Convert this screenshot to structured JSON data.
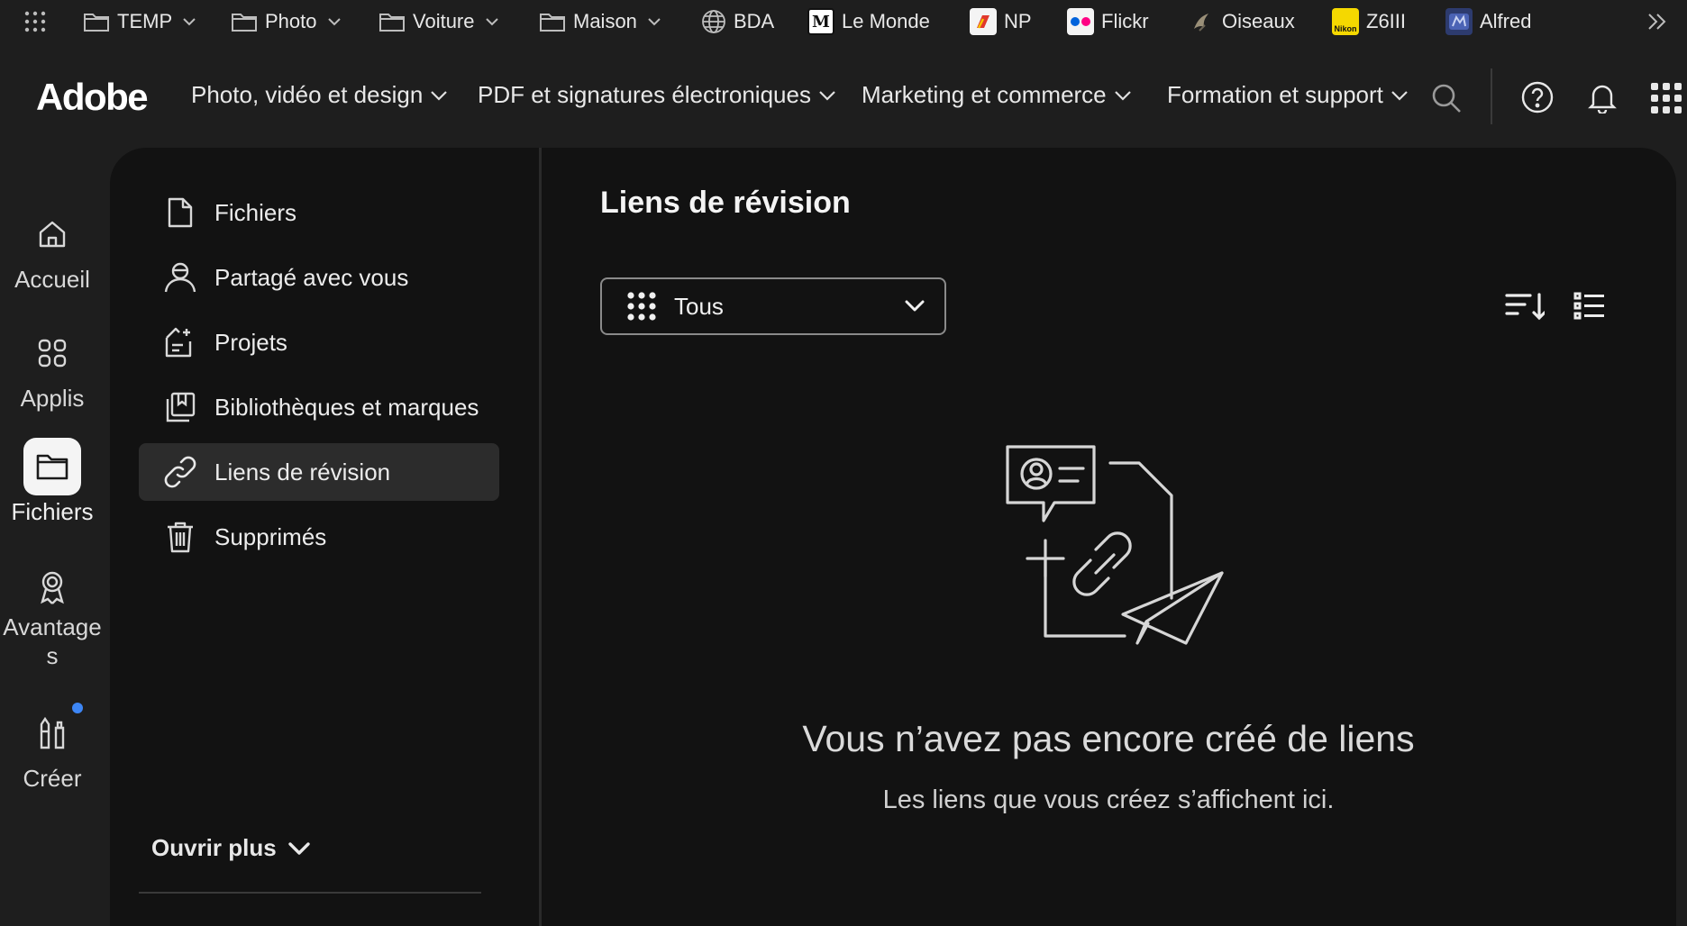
{
  "bookmarks": {
    "items": [
      {
        "label": "TEMP",
        "icon": "folder-icon",
        "dropdown": true
      },
      {
        "label": "Photo",
        "icon": "folder-icon",
        "dropdown": true
      },
      {
        "label": "Voiture",
        "icon": "folder-icon",
        "dropdown": true
      },
      {
        "label": "Maison",
        "icon": "folder-icon",
        "dropdown": true
      },
      {
        "label": "BDA",
        "icon": "globe-icon",
        "dropdown": false
      },
      {
        "label": "Le Monde",
        "icon": "le-monde-favicon",
        "dropdown": false
      },
      {
        "label": "NP",
        "icon": "np-favicon",
        "dropdown": false
      },
      {
        "label": "Flickr",
        "icon": "flickr-favicon",
        "dropdown": false
      },
      {
        "label": "Oiseaux",
        "icon": "bird-favicon",
        "dropdown": false
      },
      {
        "label": "Z6III",
        "icon": "nikon-favicon",
        "dropdown": false
      },
      {
        "label": "Alfred",
        "icon": "alfred-favicon",
        "dropdown": false
      }
    ],
    "favicon_text": {
      "le_monde": "M",
      "nikon": "Nikon"
    }
  },
  "nav": {
    "logo": "Adobe",
    "items": [
      {
        "label": "Photo, vidéo et design"
      },
      {
        "label": "PDF et signatures électroniques"
      },
      {
        "label": "Marketing et commerce"
      },
      {
        "label": "Formation et support"
      }
    ]
  },
  "rail": {
    "items": [
      {
        "label": "Accueil",
        "icon": "home-icon",
        "active": false
      },
      {
        "label": "Applis",
        "icon": "apps-icon",
        "active": false
      },
      {
        "label": "Fichiers",
        "icon": "folder-icon",
        "active": true
      },
      {
        "label": "Avantage\ns",
        "icon": "award-icon",
        "active": false
      },
      {
        "label": "Créer",
        "icon": "create-icon",
        "active": false,
        "notification": true
      }
    ]
  },
  "sidebar": {
    "items": [
      {
        "label": "Fichiers",
        "icon": "file-icon",
        "active": false
      },
      {
        "label": "Partagé avec vous",
        "icon": "shared-icon",
        "active": false
      },
      {
        "label": "Projets",
        "icon": "projects-icon",
        "active": false
      },
      {
        "label": "Bibliothèques et marques",
        "icon": "library-icon",
        "active": false
      },
      {
        "label": "Liens de révision",
        "icon": "link-icon",
        "active": true
      },
      {
        "label": "Supprimés",
        "icon": "trash-icon",
        "active": false
      }
    ],
    "open_more": "Ouvrir plus"
  },
  "main": {
    "title": "Liens de révision",
    "filter": {
      "value": "Tous"
    },
    "empty": {
      "title": "Vous n’avez pas encore créé de liens",
      "subtitle": "Les liens que vous créez s’affichent ici."
    }
  },
  "colors": {
    "background": "#1e1e1e",
    "panel": "#121212",
    "active_item": "#2c2c2c",
    "notification_dot": "#3d86f5",
    "flickr_blue": "#0063dc",
    "flickr_pink": "#ff0084"
  }
}
